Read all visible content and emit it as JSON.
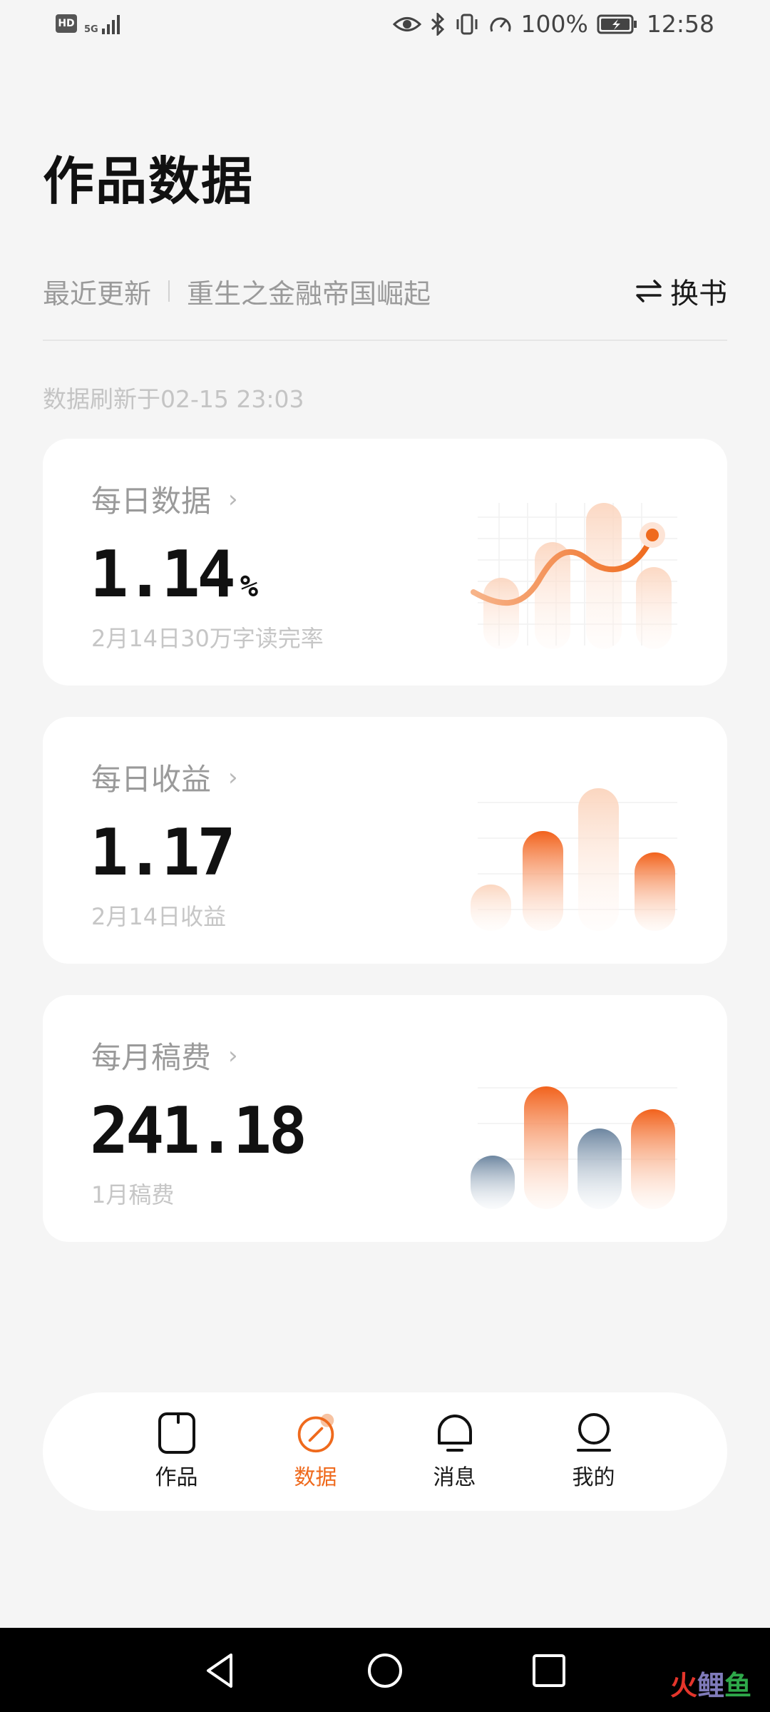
{
  "status_bar": {
    "hd": "HD",
    "network": "5G",
    "battery": "100%",
    "time": "12:58"
  },
  "header": {
    "title": "作品数据",
    "recent_label": "最近更新",
    "book_name": "重生之金融帝国崛起",
    "switch_label": "换书",
    "refresh_text": "数据刷新于02-15 23:03"
  },
  "cards": [
    {
      "title": "每日数据",
      "value": "1.14",
      "unit": "%",
      "subtitle": "2月14日30万字读完率"
    },
    {
      "title": "每日收益",
      "value": "1.17",
      "unit": "",
      "subtitle": "2月14日收益"
    },
    {
      "title": "每月稿费",
      "value": "241.18",
      "unit": "",
      "subtitle": "1月稿费"
    }
  ],
  "nav": {
    "items": [
      {
        "label": "作品",
        "icon": "book-icon"
      },
      {
        "label": "数据",
        "icon": "data-icon"
      },
      {
        "label": "消息",
        "icon": "message-icon"
      },
      {
        "label": "我的",
        "icon": "profile-icon"
      }
    ],
    "active_index": 1
  },
  "watermark": {
    "a": "火",
    "b": "鲤",
    "c": "鱼"
  },
  "colors": {
    "accent": "#ef6a1d",
    "accent_light": "#fbd9c4",
    "slate": "#6d86a0",
    "background": "#f5f5f5",
    "card": "#ffffff"
  }
}
